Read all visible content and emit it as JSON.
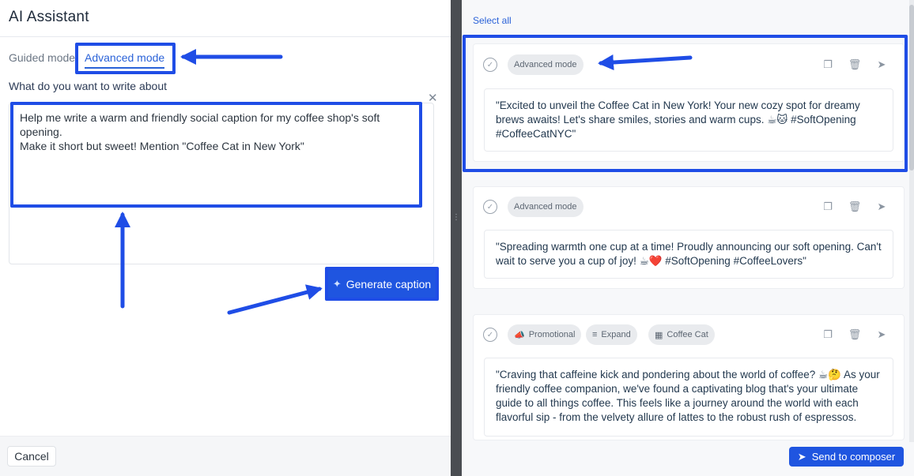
{
  "app": {
    "title": "AI Assistant"
  },
  "modes": {
    "guided": "Guided mode",
    "advanced": "Advanced mode"
  },
  "prompt": {
    "label": "What do you want to write about",
    "value": "Help me write a warm and friendly social caption for my coffee shop's soft opening.\nMake it short but sweet! Mention \"Coffee Cat in New York\""
  },
  "actions": {
    "generate": "Generate caption",
    "cancel": "Cancel",
    "select_all": "Select all",
    "send_to_composer": "Send to composer"
  },
  "results": [
    {
      "tags": [
        "Advanced mode"
      ],
      "text": "\"Excited to unveil the Coffee Cat in New York! Your new cozy spot for dreamy brews awaits! Let's share smiles, stories and warm cups. ☕🐱 #SoftOpening #CoffeeCatNYC\""
    },
    {
      "tags": [
        "Advanced mode"
      ],
      "text": "\"Spreading warmth one cup at a time! Proudly announcing our soft opening. Can't wait to serve you a cup of joy! ☕❤️ #SoftOpening #CoffeeLovers\""
    },
    {
      "tags": [
        "Promotional",
        "Expand",
        "Coffee Cat"
      ],
      "text": "\"Craving that caffeine kick and pondering about the world of coffee? ☕🤔 As your friendly coffee companion, we've found a captivating blog that's your ultimate guide to all things coffee. This feels like a journey around the world with each flavorful sip - from the velvety allure of lattes to the robust rush of espressos."
    }
  ],
  "icons": {
    "generate": "sparkle-icon",
    "send": "paper-plane-icon",
    "copy": "copy-icon",
    "delete": "trash-icon",
    "select": "check-circle-icon",
    "close": "close-icon"
  },
  "colors": {
    "accent": "#1f55e0",
    "annotation": "#1f4de6",
    "divider": "#4a4d52"
  }
}
